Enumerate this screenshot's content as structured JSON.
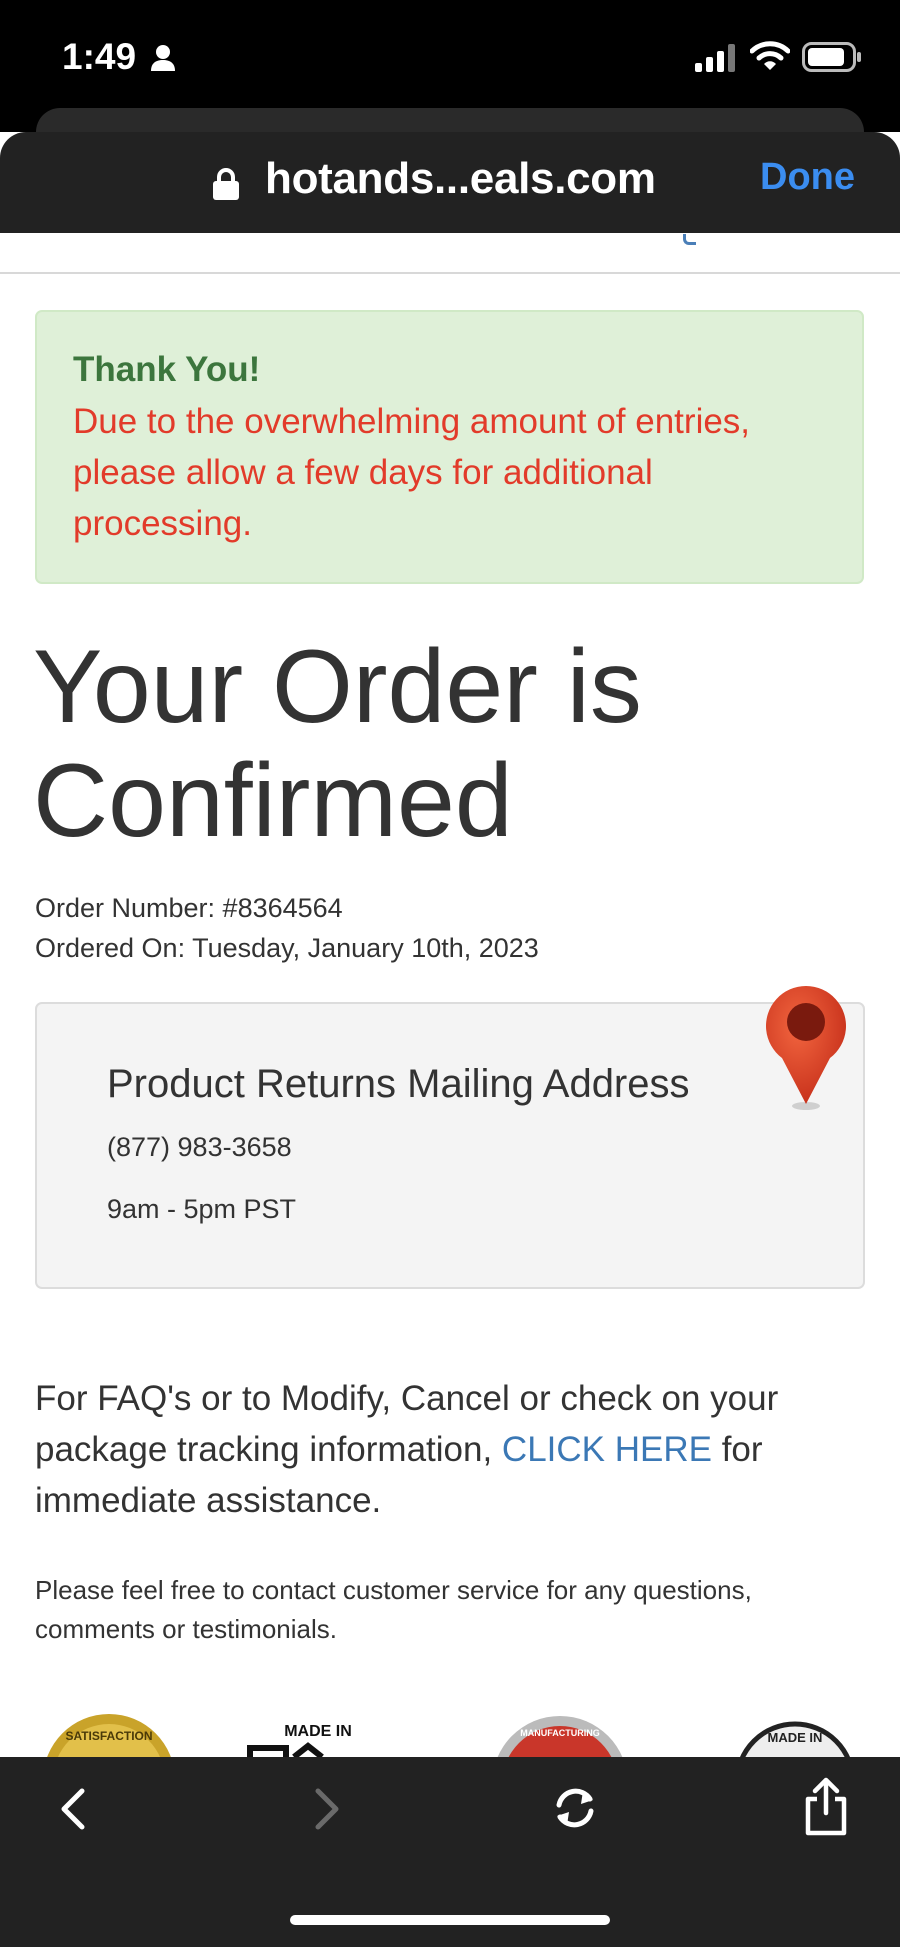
{
  "status_bar": {
    "time": "1:49"
  },
  "browser": {
    "url": "hotands...eals.com",
    "done_label": "Done"
  },
  "alert": {
    "title": "Thank You!",
    "message": "Due to the overwhelming amount of entries, please allow a few days for additional processing."
  },
  "page": {
    "title": "Your Order is Confirmed",
    "order_number": "Order Number: #8364564",
    "ordered_on": "Ordered On: Tuesday, January 10th, 2023"
  },
  "returns": {
    "heading": "Product Returns Mailing Address",
    "phone": "(877) 983-3658",
    "hours": "9am - 5pm PST"
  },
  "faq": {
    "text_before": "For FAQ's or to Modify, Cancel or check on your package tracking information, ",
    "link_label": "CLICK HERE",
    "text_after": " for immediate assistance."
  },
  "contact": {
    "text": "Please feel free to contact customer service for any questions, comments or testimonials."
  },
  "badges": {
    "satisfaction": "SATISFACTION",
    "made_in": "MADE IN",
    "manufacturing": "MANUFACTURING",
    "made_in_usa": "MADE IN"
  },
  "colors": {
    "alert_bg": "#dff0d8",
    "alert_title": "#3c763d",
    "alert_text": "#e23b2a",
    "link": "#3b78b5",
    "done": "#3b8df0",
    "pin": "#e0402a"
  }
}
